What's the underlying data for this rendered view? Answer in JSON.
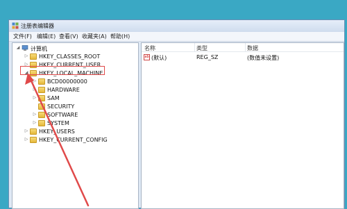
{
  "window": {
    "title": "注册表编辑器"
  },
  "menu": [
    "文件(F)",
    "编辑(E)",
    "查看(V)",
    "收藏夹(A)",
    "帮助(H)"
  ],
  "tree": {
    "root": "计算机",
    "keys": [
      "HKEY_CLASSES_ROOT",
      "HKEY_CURRENT_USER",
      "HKEY_LOCAL_MACHINE",
      "BCD00000000",
      "HARDWARE",
      "SAM",
      "SECURITY",
      "SOFTWARE",
      "SYSTEM",
      "HKEY_USERS",
      "HKEY_CURRENT_CONFIG"
    ]
  },
  "list": {
    "headers": [
      "名称",
      "类型",
      "数据"
    ],
    "rows": [
      {
        "name": "(默认)",
        "type": "REG_SZ",
        "data": "(数值未设置)"
      }
    ],
    "icon_text": "ab"
  },
  "annotation_color": "#e04a4a"
}
